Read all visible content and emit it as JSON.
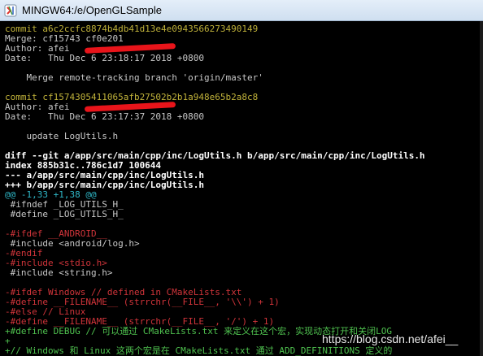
{
  "window": {
    "title": "MINGW64:/e/OpenGLSample",
    "icon": "mingw-terminal-icon"
  },
  "colors": {
    "background": "#000000",
    "default_text": "#c8c8c8",
    "commit_hash": "#c0b23a",
    "diff_bold": "#ffffff",
    "hunk_header": "#2fb8c8",
    "removed": "#d0343a",
    "added": "#4fc24f",
    "redaction_stroke": "#e8141a"
  },
  "terminal": {
    "lines": [
      {
        "text": "commit a6c2ccfc8874b4db41d13e4e0943566273490149",
        "kind": "commit"
      },
      {
        "text": "Merge: cf15743 cf0e201",
        "kind": "plain"
      },
      {
        "text": "Author: afei",
        "kind": "plain"
      },
      {
        "text": "Date:   Thu Dec 6 23:18:17 2018 +0800",
        "kind": "plain"
      },
      {
        "text": "",
        "kind": "plain"
      },
      {
        "text": "    Merge remote-tracking branch 'origin/master'",
        "kind": "plain"
      },
      {
        "text": "",
        "kind": "plain"
      },
      {
        "text": "commit cf1574305411065afb27502b2b1a948e65b2a8c8",
        "kind": "commit"
      },
      {
        "text": "Author: afei",
        "kind": "plain"
      },
      {
        "text": "Date:   Thu Dec 6 23:17:37 2018 +0800",
        "kind": "plain"
      },
      {
        "text": "",
        "kind": "plain"
      },
      {
        "text": "    update LogUtils.h",
        "kind": "plain"
      },
      {
        "text": "",
        "kind": "plain"
      },
      {
        "text": "diff --git a/app/src/main/cpp/inc/LogUtils.h b/app/src/main/cpp/inc/LogUtils.h",
        "kind": "bold"
      },
      {
        "text": "index 885b31c..786c1d7 100644",
        "kind": "bold"
      },
      {
        "text": "--- a/app/src/main/cpp/inc/LogUtils.h",
        "kind": "bold"
      },
      {
        "text": "+++ b/app/src/main/cpp/inc/LogUtils.h",
        "kind": "bold"
      },
      {
        "text": "@@ -1,33 +1,38 @@",
        "kind": "hunk"
      },
      {
        "text": " #ifndef _LOG_UTILS_H_",
        "kind": "plain"
      },
      {
        "text": " #define _LOG_UTILS_H_",
        "kind": "plain"
      },
      {
        "text": "",
        "kind": "plain"
      },
      {
        "text": "-#ifdef __ANDROID__",
        "kind": "removed"
      },
      {
        "text": " #include <android/log.h>",
        "kind": "plain"
      },
      {
        "text": "-#endif",
        "kind": "removed"
      },
      {
        "text": "-#include <stdio.h>",
        "kind": "removed"
      },
      {
        "text": " #include <string.h>",
        "kind": "plain"
      },
      {
        "text": "",
        "kind": "plain"
      },
      {
        "text": "-#ifdef Windows // defined in CMakeLists.txt",
        "kind": "removed"
      },
      {
        "text": "-#define __FILENAME__ (strrchr(__FILE__, '\\\\') + 1)",
        "kind": "removed"
      },
      {
        "text": "-#else // Linux",
        "kind": "removed"
      },
      {
        "text": "-#define __FILENAME__ (strrchr(__FILE__, '/') + 1)",
        "kind": "removed"
      },
      {
        "text": "+#define DEBUG // 可以通过 CMakeLists.txt 来定义在这个宏，实现动态打开和关闭LOG",
        "kind": "added"
      },
      {
        "text": "+",
        "kind": "added"
      },
      {
        "text": "+// Windows 和 Linux 这两个宏是在 CMakeLists.txt 通过 ADD_DEFINITIONS 定义的",
        "kind": "added"
      }
    ]
  },
  "watermark": "https://blog.csdn.net/afei__"
}
